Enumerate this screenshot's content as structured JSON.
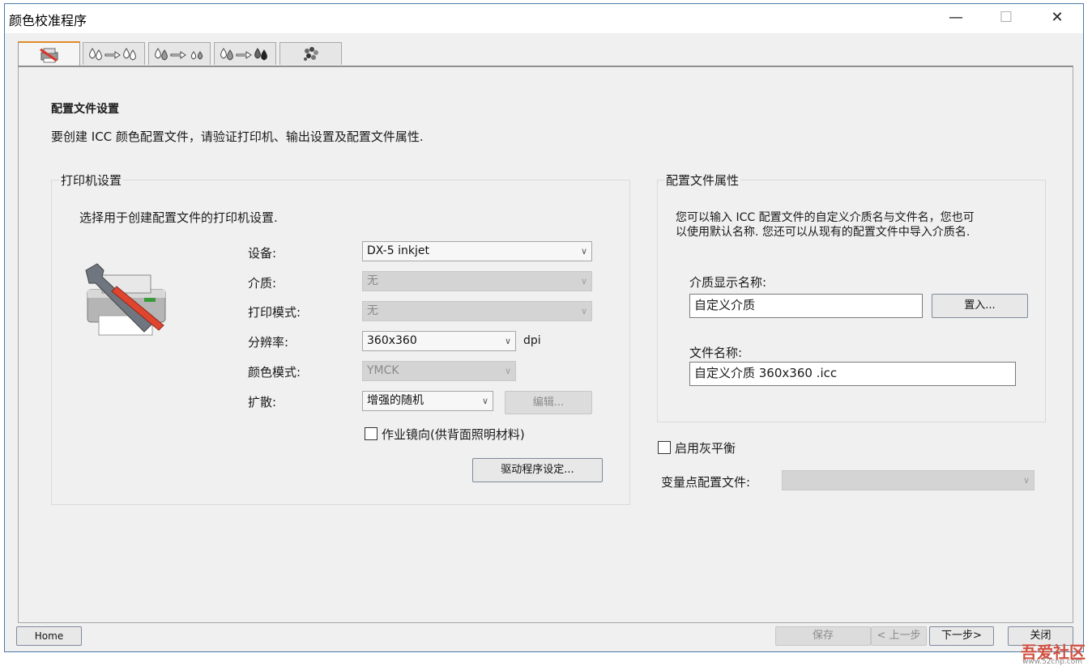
{
  "window": {
    "title": "颜色校准程序"
  },
  "title_buttons": {
    "minimize": "—",
    "maximize": "☐",
    "close": "✕"
  },
  "tabs": [
    {
      "icon": "printer-settings-icon"
    },
    {
      "icon": "ink-limit-icon"
    },
    {
      "icon": "linearization-icon"
    },
    {
      "icon": "ink-total-icon"
    },
    {
      "icon": "profile-icon"
    }
  ],
  "page": {
    "heading": "配置文件设置",
    "description": "要创建 ICC 颜色配置文件，请验证打印机、输出设置及配置文件属性."
  },
  "printer_settings": {
    "title": "打印机设置",
    "intro": "选择用于创建配置文件的打印机设置.",
    "device": {
      "label": "设备:",
      "value": "DX-5 inkjet"
    },
    "media": {
      "label": "介质:",
      "value": "无"
    },
    "print_mode": {
      "label": "打印模式:",
      "value": "无"
    },
    "resolution": {
      "label": "分辨率:",
      "value": "360x360",
      "unit": "dpi"
    },
    "color_mode": {
      "label": "颜色模式:",
      "value": "YMCK"
    },
    "dithering": {
      "label": "扩散:",
      "value": "增强的随机",
      "edit_label": "编辑..."
    },
    "mirror": {
      "label": "作业镜向(供背面照明材料)",
      "checked": false
    },
    "driver_button": "驱动程序设定..."
  },
  "profile_properties": {
    "title": "配置文件属性",
    "intro_line1": "您可以输入 ICC 配置文件的自定义介质名与文件名，您也可",
    "intro_line2": "以使用默认名称. 您还可以从现有的配置文件中导入介质名.",
    "media_name_label": "介质显示名称:",
    "media_name_value": "自定义介质",
    "import_button": "置入...",
    "file_name_label": "文件名称:",
    "file_name_value": "自定义介质 360x360 .icc"
  },
  "gray_balance": {
    "label": "启用灰平衡",
    "checked": false
  },
  "variable_dot": {
    "label": "变量点配置文件:",
    "value": ""
  },
  "footer": {
    "home": "Home",
    "save": "保存",
    "prev": "< 上一步",
    "next": "下一步>",
    "close": "关闭"
  },
  "watermark": {
    "text": "吾爱社区",
    "url_text": "www.52cnp.com"
  }
}
